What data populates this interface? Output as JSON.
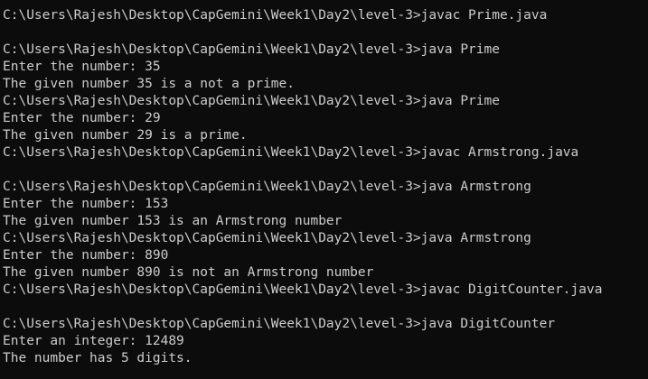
{
  "colors": {
    "background": "#0c0c0c",
    "foreground": "#cccccc"
  },
  "terminal": {
    "lines": [
      "C:\\Users\\Rajesh\\Desktop\\CapGemini\\Week1\\Day2\\level-3>javac Prime.java",
      "",
      "C:\\Users\\Rajesh\\Desktop\\CapGemini\\Week1\\Day2\\level-3>java Prime",
      "Enter the number: 35",
      "The given number 35 is a not a prime.",
      "C:\\Users\\Rajesh\\Desktop\\CapGemini\\Week1\\Day2\\level-3>java Prime",
      "Enter the number: 29",
      "The given number 29 is a prime.",
      "C:\\Users\\Rajesh\\Desktop\\CapGemini\\Week1\\Day2\\level-3>javac Armstrong.java",
      "",
      "C:\\Users\\Rajesh\\Desktop\\CapGemini\\Week1\\Day2\\level-3>java Armstrong",
      "Enter the number: 153",
      "The given number 153 is an Armstrong number",
      "C:\\Users\\Rajesh\\Desktop\\CapGemini\\Week1\\Day2\\level-3>java Armstrong",
      "Enter the number: 890",
      "The given number 890 is not an Armstrong number",
      "C:\\Users\\Rajesh\\Desktop\\CapGemini\\Week1\\Day2\\level-3>javac DigitCounter.java",
      "",
      "C:\\Users\\Rajesh\\Desktop\\CapGemini\\Week1\\Day2\\level-3>java DigitCounter",
      "Enter an integer: 12489",
      "The number has 5 digits."
    ]
  }
}
